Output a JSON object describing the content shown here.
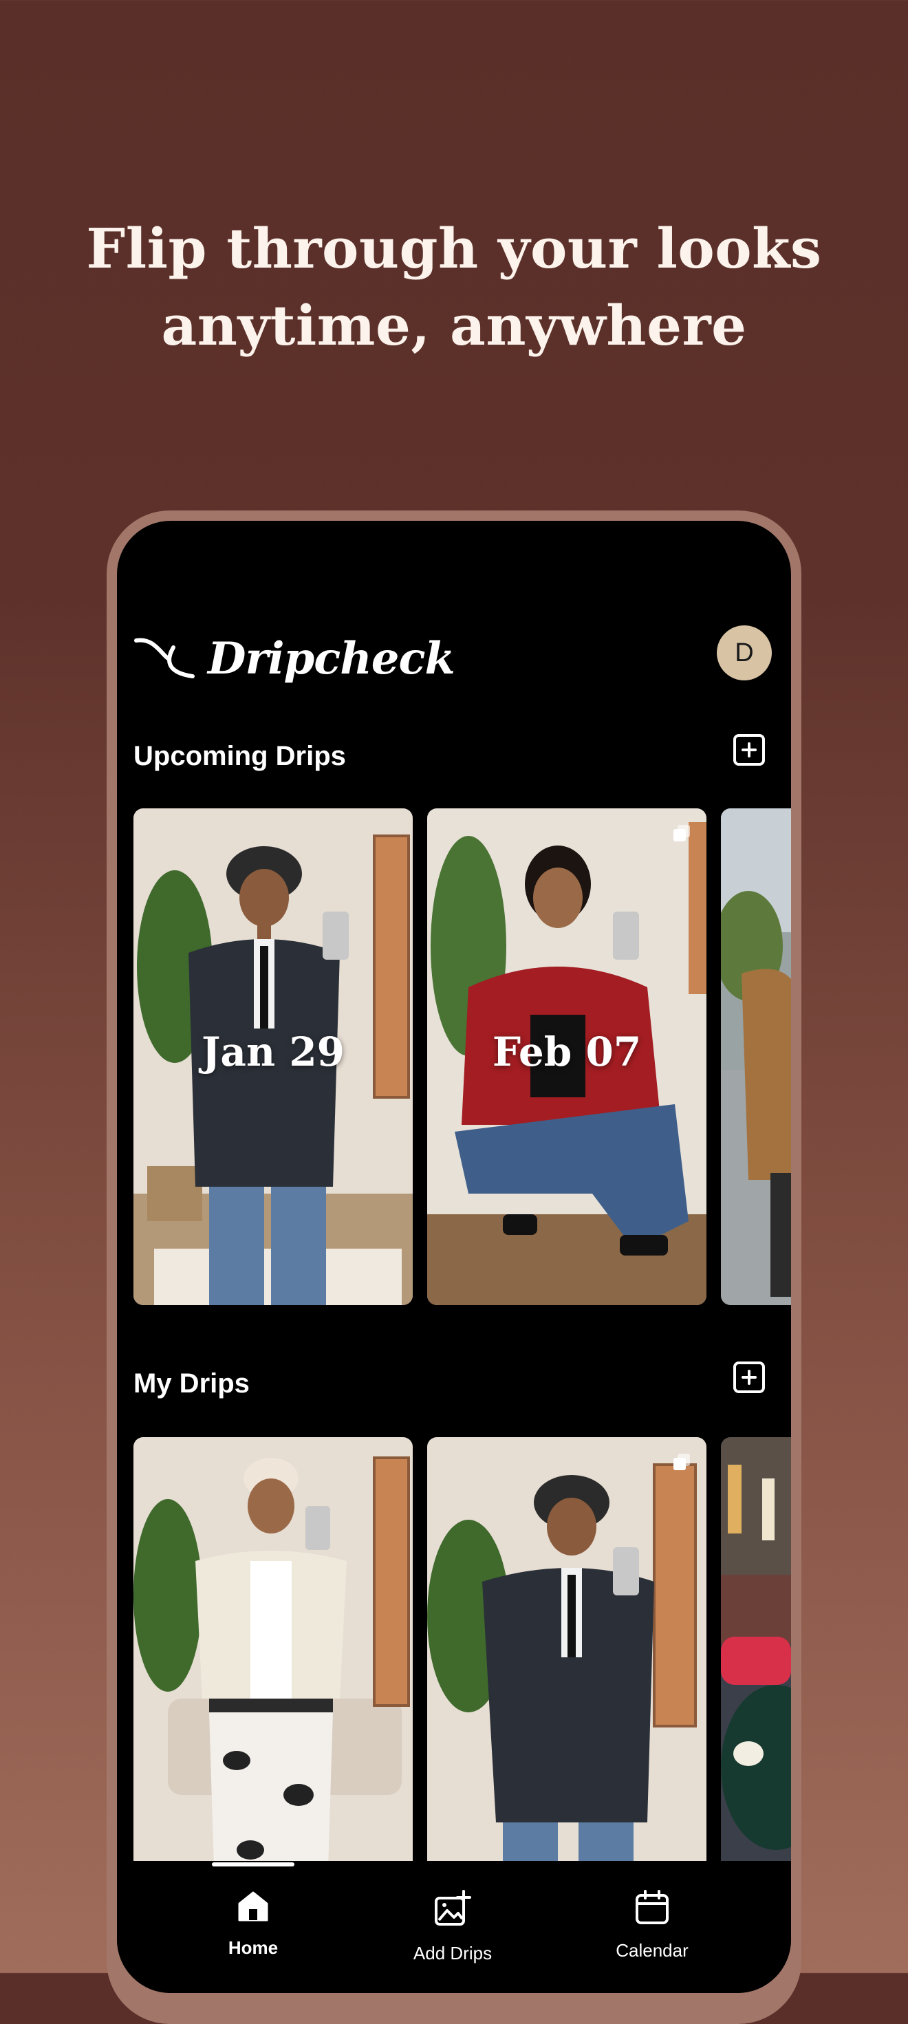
{
  "headline": {
    "line1": "Flip through your looks",
    "line2": "anytime, anywhere"
  },
  "app": {
    "name": "Dripcheck",
    "avatar_initial": "D"
  },
  "upcoming": {
    "title": "Upcoming Drips",
    "cards": [
      {
        "date": "Jan 29"
      },
      {
        "date": "Feb 07"
      },
      {
        "date": ""
      }
    ]
  },
  "my_drips": {
    "title": "My Drips"
  },
  "nav": [
    {
      "label": "Home",
      "icon": "home-icon",
      "active": true
    },
    {
      "label": "Add Drips",
      "icon": "add-image-icon",
      "active": false
    },
    {
      "label": "Calendar",
      "icon": "calendar-icon",
      "active": false
    }
  ],
  "colors": {
    "background": "#5a2f29",
    "phone_frame": "#a27769",
    "avatar": "#d8c3a5"
  }
}
